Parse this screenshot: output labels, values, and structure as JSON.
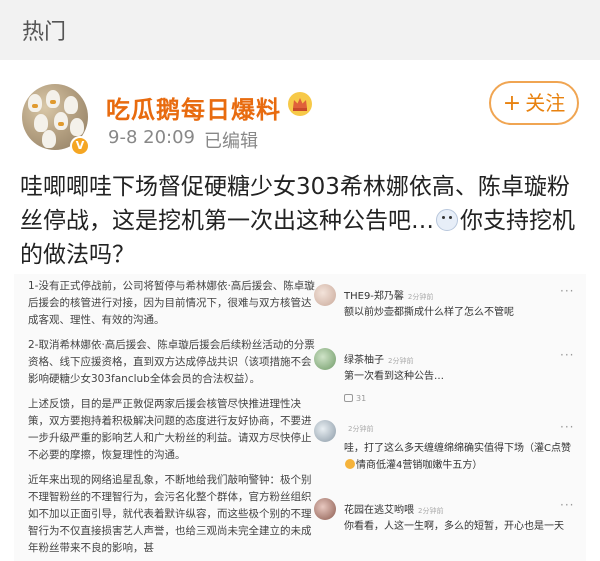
{
  "header": {
    "title": "热门"
  },
  "post": {
    "author": "吃瓜鹅每日爆料",
    "time": "9-8 20:09",
    "edited": "已编辑",
    "follow_label": "关注",
    "text_part1": "哇唧唧哇下场督促硬糖少女303希林娜依高、陈卓璇粉丝停战，这是挖机第一次出这种公告吧…",
    "text_part2": "你支持挖机的做法吗？"
  },
  "image": {
    "notice": [
      "1-没有正式停战前，公司将暂停与希林娜依·高后援会、陈卓璇后援会的核管进行对接，因为目前情况下，很难与双方核管达成客观、理性、有效的沟通。",
      "2-取消希林娜依·高后援会、陈卓璇后援会后续粉丝活动的分票资格、线下应援资格，直到双方达成停战共识（该项措施不会影响硬糖少女303fanclub全体会员的合法权益）。",
      "上述反馈，目的是严正敦促两家后援会核管尽快推进理性决策，双方要抱持着积极解决问题的态度进行友好协商，不要进一步升级严重的影响艺人和广大粉丝的利益。请双方尽快停止不必要的摩擦，恢复理性的沟通。",
      "近年来出现的网络追星乱象，不断地给我们敲响警钟：极个别不理智粉丝的不理智行为，会污名化整个群体，官方粉丝组织如不加以正面引导，就代表着默许纵容，而这些极个别的不理智行为不仅直接损害艺人声誉，也给三观尚未完全建立的未成年粉丝带来不良的影响，甚"
    ],
    "comments": [
      {
        "name": "THE9-郑乃馨",
        "time": "2分钟前",
        "text": "额以前炒壶都撕成什么样了怎么不管呢",
        "likes": ""
      },
      {
        "name": "绿茶柚子",
        "time": "2分钟前",
        "text": "第一次看到这种公告…",
        "likes": "31"
      },
      {
        "name": "",
        "time": "2分钟前",
        "text_part1": "哇，打了这么多天缠缠绵绵确实值得下场（灌C点赞",
        "text_part2": "情商低灌4营销咖嫩牛五方）",
        "likes": ""
      },
      {
        "name": "花园在逃艾哟喂",
        "time": "2分钟前",
        "text": "你看看，人这一生啊，多么的短暂，开心也是一天",
        "likes": ""
      }
    ],
    "more_icon": "···"
  },
  "colors": {
    "author": "#e86b0f",
    "follow": "#e8820f"
  }
}
